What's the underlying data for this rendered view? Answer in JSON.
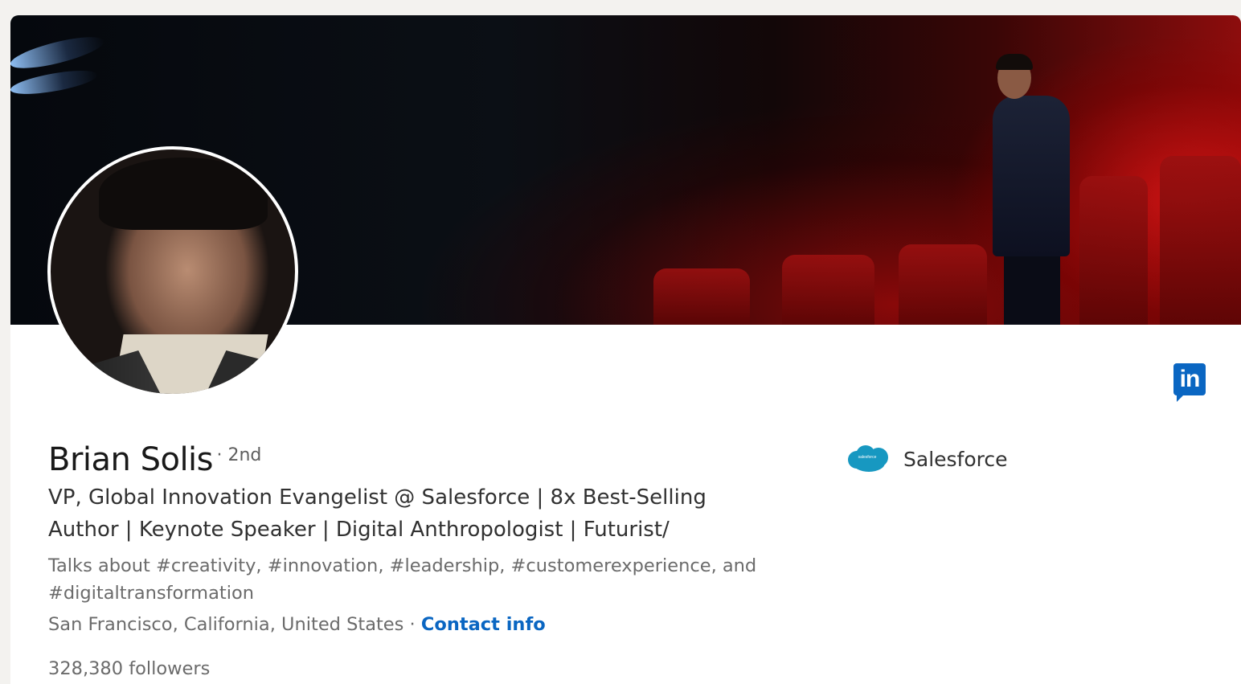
{
  "profile": {
    "name": "Brian Solis",
    "degree": "· 2nd",
    "headline": "VP, Global Innovation Evangelist @ Salesforce | 8x Best-Selling Author | Keynote Speaker | Digital Anthropologist | Futurist/",
    "talks_about": "Talks about #creativity, #innovation, #leadership, #customerexperience, and #digitaltransformation",
    "location": "San Francisco, California, United States",
    "location_separator": " · ",
    "contact_info_label": "Contact info",
    "followers": "328,380 followers"
  },
  "company": {
    "name": "Salesforce",
    "logo_text": "salesforce",
    "logo_color": "#1798c1"
  },
  "linkedin_logo": {
    "text": "in",
    "color": "#0a66c2"
  },
  "icons": {
    "banner": "cover-photo",
    "avatar": "profile-photo",
    "brand": "linkedin-icon",
    "company_logo": "salesforce-cloud-logo"
  }
}
